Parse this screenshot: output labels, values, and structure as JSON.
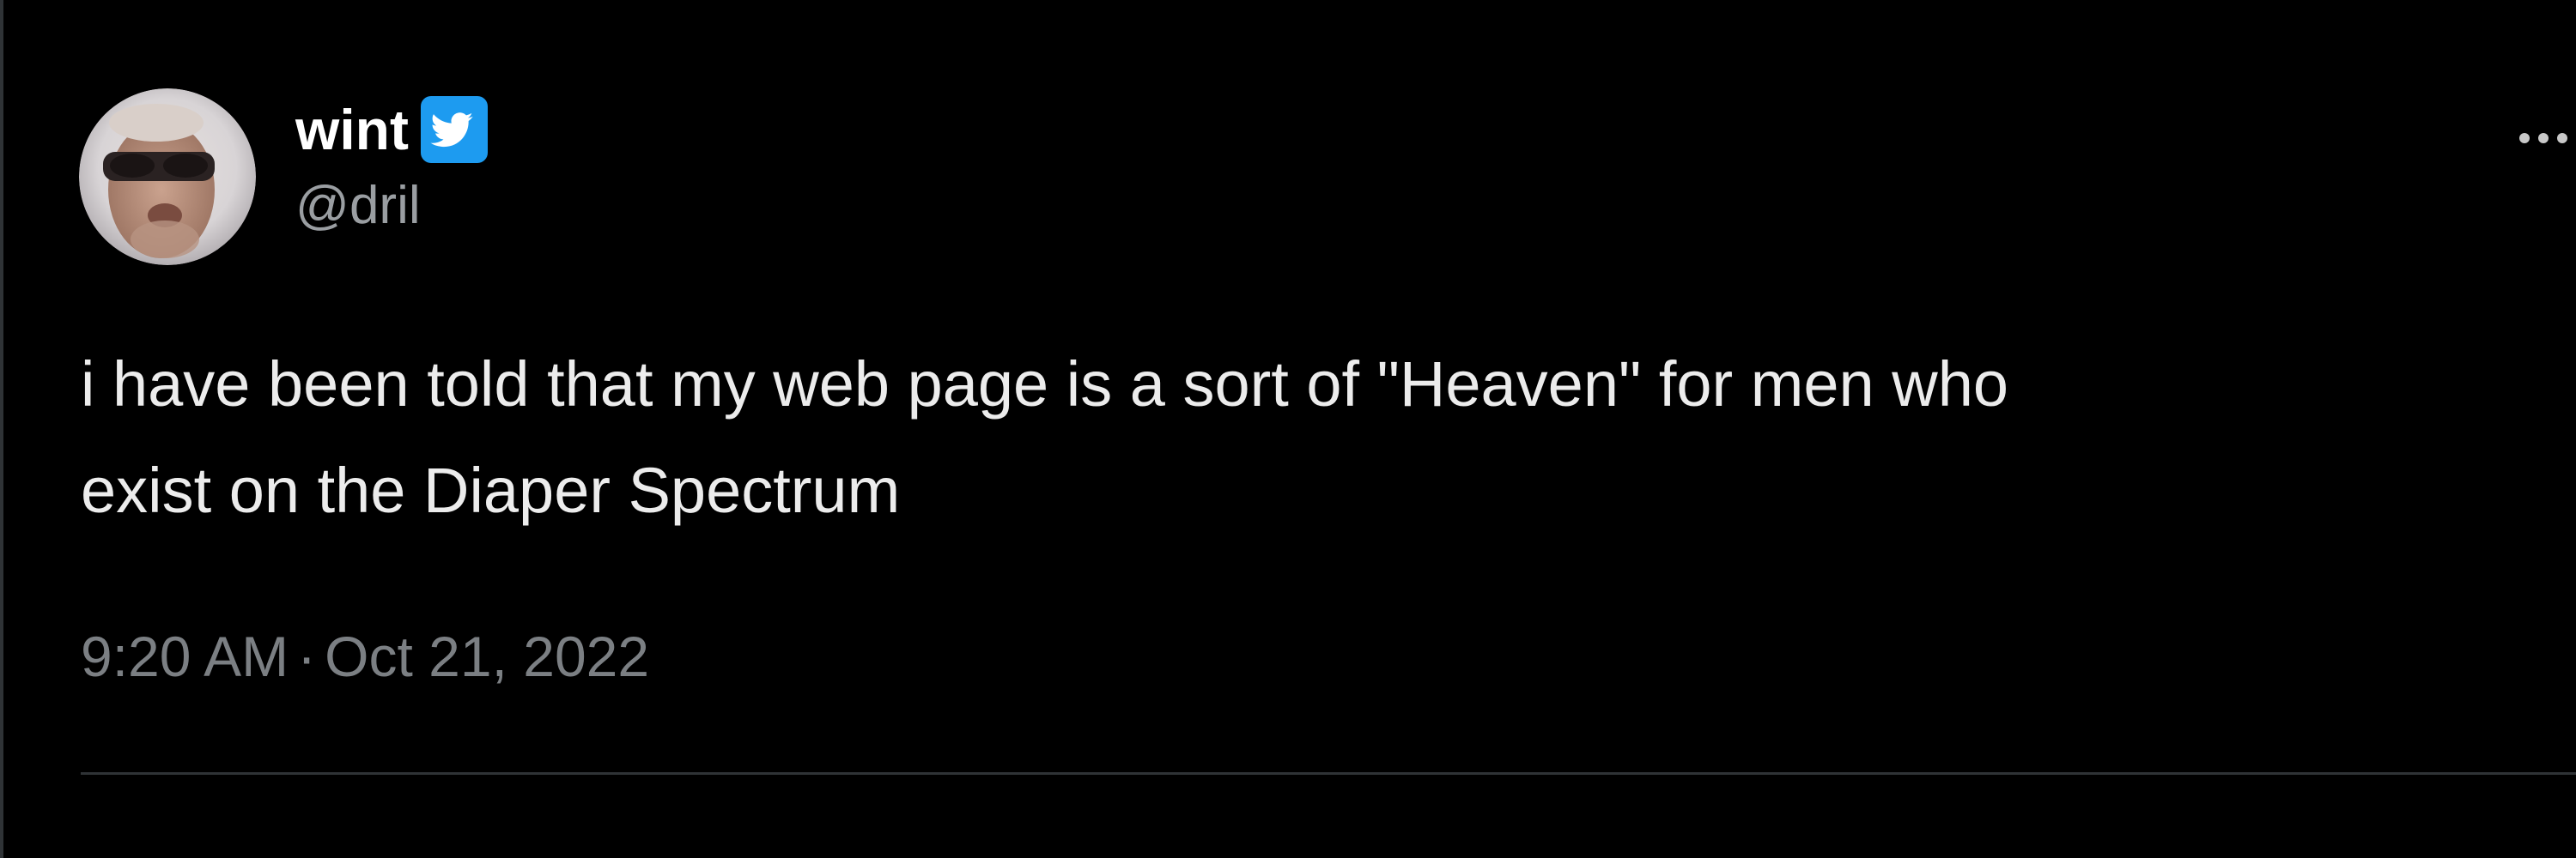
{
  "tweet": {
    "author": {
      "display_name": "wint",
      "handle": "@dril",
      "verified_icon": "twitter-bird-verified-icon",
      "avatar_icon": "avatar-photo"
    },
    "text": "i have been told that my web page is a sort of \"Heaven\" for men who\nexist on the Diaper Spectrum",
    "time": "9:20 AM",
    "separator": "·",
    "date": "Oct 21, 2022",
    "more_icon": "more-options-icon"
  },
  "colors": {
    "background": "#000000",
    "text": "#e7e9ea",
    "secondary_text": "#7b7f83",
    "verified_badge": "#1d9bf0",
    "divider": "#2f3336"
  }
}
